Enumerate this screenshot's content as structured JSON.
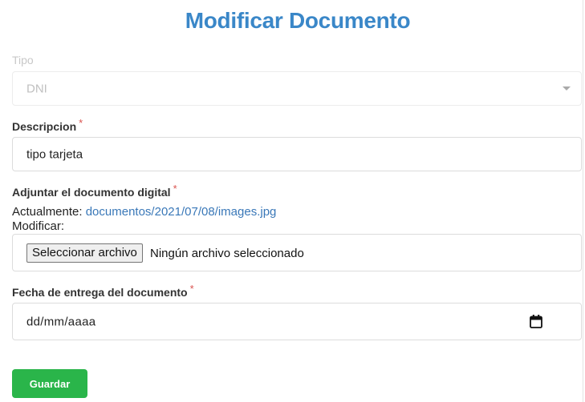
{
  "page": {
    "title": "Modificar Documento"
  },
  "tipo": {
    "label": "Tipo",
    "value": "DNI"
  },
  "descripcion": {
    "label": "Descripcion",
    "required_mark": "*",
    "value": "tipo tarjeta"
  },
  "adjunto": {
    "label": "Adjuntar el documento digital",
    "required_mark": "*",
    "current_prefix": "Actualmente:",
    "current_link": "documentos/2021/07/08/images.jpg",
    "modify_label": "Modificar:",
    "choose_button": "Seleccionar archivo",
    "status": "Ningún archivo seleccionado"
  },
  "fecha": {
    "label": "Fecha de entrega del documento",
    "required_mark": "*",
    "placeholder": "dd/mm/aaaa",
    "icon": "calendar-icon"
  },
  "actions": {
    "save_label": "Guardar"
  },
  "colors": {
    "title": "#3a87c8",
    "link": "#3a78b8",
    "required": "#d9534f",
    "save": "#2ab54a"
  }
}
